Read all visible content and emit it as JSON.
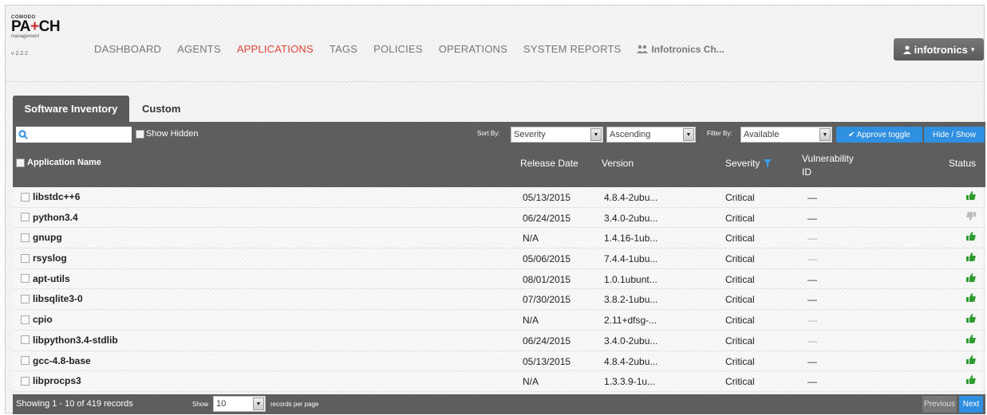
{
  "brand": {
    "company": "COMODO",
    "product_a": "PA",
    "product_plus": "+",
    "product_b": "CH",
    "subtitle": "management",
    "version": "v 2.2.2"
  },
  "nav": {
    "items": [
      "DASHBOARD",
      "AGENTS",
      "APPLICATIONS",
      "TAGS",
      "POLICIES",
      "OPERATIONS",
      "SYSTEM REPORTS"
    ],
    "active": "APPLICATIONS",
    "org_label": "Infotronics Ch...",
    "user_label": "infotronics"
  },
  "tabs": [
    {
      "label": "Software Inventory",
      "active": true
    },
    {
      "label": "Custom",
      "active": false
    }
  ],
  "toolbar": {
    "search_placeholder": "",
    "show_hidden_label": "Show Hidden",
    "sort_by_label": "Sort By:",
    "sort_field": "Severity",
    "sort_order": "Ascending",
    "filter_by_label": "Filter By:",
    "filter_value": "Available",
    "approve_toggle_label": "✔ Approve toggle",
    "hide_show_label": "Hide / Show"
  },
  "columns": {
    "name": "Application Name",
    "release_date": "Release Date",
    "version": "Version",
    "severity": "Severity",
    "vulnerability": "Vulnerability",
    "vulnerability_id": "ID",
    "status": "Status"
  },
  "rows": [
    {
      "name": "libstdc++6",
      "release_date": "05/13/2015",
      "version": "4.8.4-2ubu...",
      "severity": "Critical",
      "vuln": "—",
      "status": "approved"
    },
    {
      "name": "python3.4",
      "release_date": "06/24/2015",
      "version": "3.4.0-2ubu...",
      "severity": "Critical",
      "vuln": "—",
      "status": "pending"
    },
    {
      "name": "gnupg",
      "release_date": "N/A",
      "version": "1.4.16-1ub...",
      "severity": "Critical",
      "vuln": "—",
      "status": "approved"
    },
    {
      "name": "rsyslog",
      "release_date": "05/06/2015",
      "version": "7.4.4-1ubu...",
      "severity": "Critical",
      "vuln": "—",
      "status": "approved"
    },
    {
      "name": "apt-utils",
      "release_date": "08/01/2015",
      "version": "1.0.1ubunt...",
      "severity": "Critical",
      "vuln": "—",
      "status": "approved"
    },
    {
      "name": "libsqlite3-0",
      "release_date": "07/30/2015",
      "version": "3.8.2-1ubu...",
      "severity": "Critical",
      "vuln": "—",
      "status": "approved"
    },
    {
      "name": "cpio",
      "release_date": "N/A",
      "version": "2.11+dfsg-...",
      "severity": "Critical",
      "vuln": "—",
      "status": "approved"
    },
    {
      "name": "libpython3.4-stdlib",
      "release_date": "06/24/2015",
      "version": "3.4.0-2ubu...",
      "severity": "Critical",
      "vuln": "—",
      "status": "approved"
    },
    {
      "name": "gcc-4.8-base",
      "release_date": "05/13/2015",
      "version": "4.8.4-2ubu...",
      "severity": "Critical",
      "vuln": "—",
      "status": "approved"
    },
    {
      "name": "libprocps3",
      "release_date": "N/A",
      "version": "1.3.3.9-1u...",
      "severity": "Critical",
      "vuln": "—",
      "status": "approved"
    }
  ],
  "footer": {
    "records_info": "Showing 1 - 10 of 419 records",
    "show_label": "Show",
    "page_size": "10",
    "per_page_label": "records per page",
    "previous_label": "Previous",
    "next_label": "Next"
  },
  "colors": {
    "accent_red": "#e0443a",
    "approve_green": "#2e9b2e",
    "pending_gray": "#bbbbbb",
    "blue_button": "#2f8fe0",
    "filter_icon": "#3aa0e8"
  }
}
